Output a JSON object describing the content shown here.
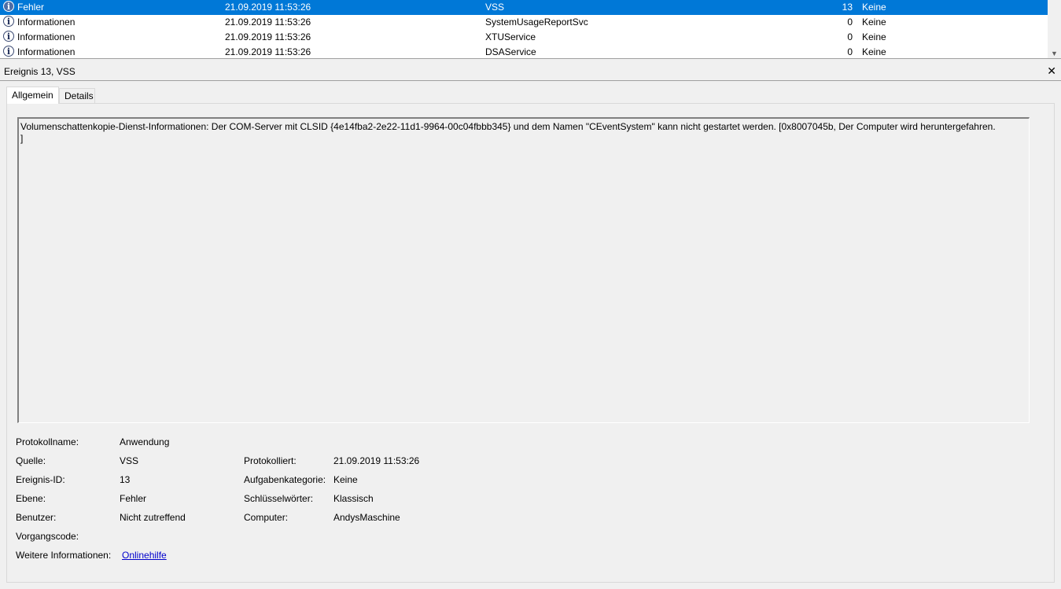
{
  "events": [
    {
      "level": "Fehler",
      "date": "21.09.2019 11:53:26",
      "source": "VSS",
      "id": "13",
      "task": "Keine",
      "selected": true
    },
    {
      "level": "Informationen",
      "date": "21.09.2019 11:53:26",
      "source": "SystemUsageReportSvc",
      "id": "0",
      "task": "Keine",
      "selected": false
    },
    {
      "level": "Informationen",
      "date": "21.09.2019 11:53:26",
      "source": "XTUService",
      "id": "0",
      "task": "Keine",
      "selected": false
    },
    {
      "level": "Informationen",
      "date": "21.09.2019 11:53:26",
      "source": "DSAService",
      "id": "0",
      "task": "Keine",
      "selected": false
    }
  ],
  "detail": {
    "title": "Ereignis 13, VSS",
    "close": "✕",
    "tabs": {
      "general": "Allgemein",
      "details": "Details"
    },
    "message": "Volumenschattenkopie-Dienst-Informationen: Der COM-Server mit CLSID {4e14fba2-2e22-11d1-9964-00c04fbbb345} und dem Namen \"CEventSystem\" kann nicht gestartet werden. [0x8007045b, Der Computer wird heruntergefahren.\n]",
    "labels": {
      "log_name": "Protokollname:",
      "source": "Quelle:",
      "event_id": "Ereignis-ID:",
      "level": "Ebene:",
      "user": "Benutzer:",
      "opcode": "Vorgangscode:",
      "more_info": "Weitere Informationen:",
      "logged": "Protokolliert:",
      "task_category": "Aufgabenkategorie:",
      "keywords": "Schlüsselwörter:",
      "computer": "Computer:"
    },
    "values": {
      "log_name": "Anwendung",
      "source": "VSS",
      "event_id": "13",
      "level": "Fehler",
      "user": "Nicht zutreffend",
      "opcode": "",
      "more_info": "Onlinehilfe",
      "logged": "21.09.2019 11:53:26",
      "task_category": "Keine",
      "keywords": "Klassisch",
      "computer": "AndysMaschine"
    }
  }
}
